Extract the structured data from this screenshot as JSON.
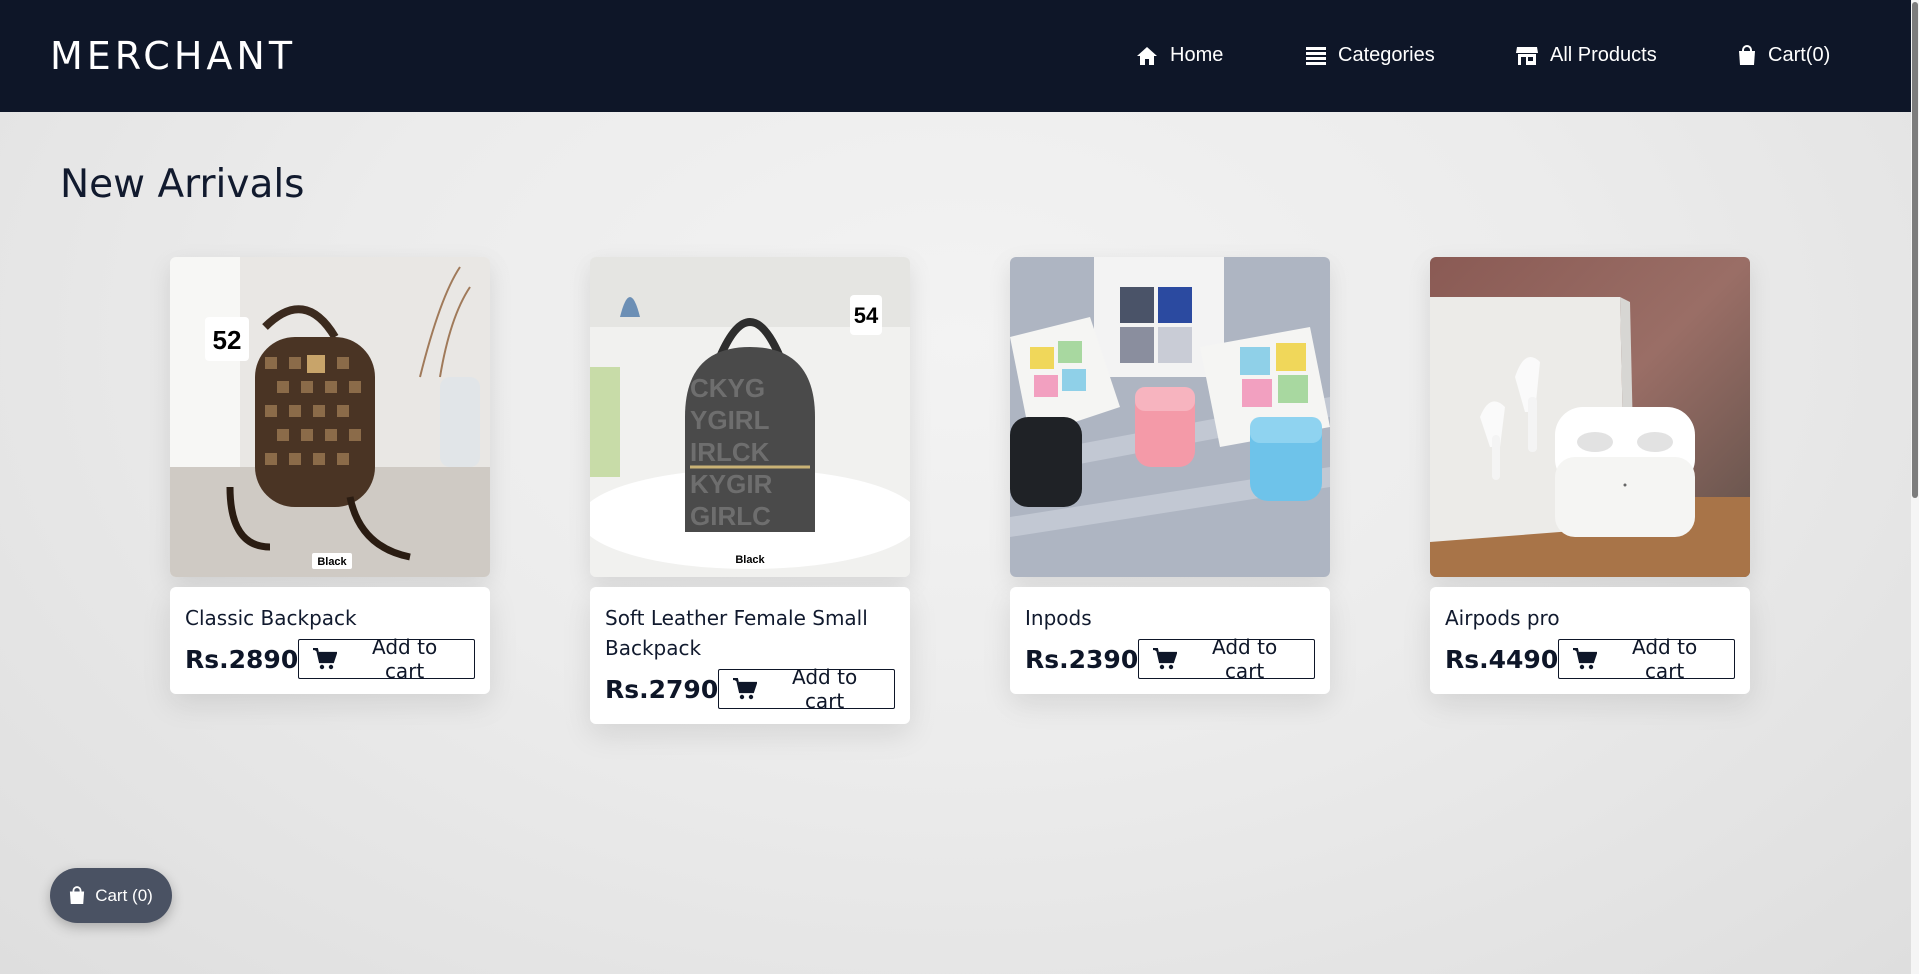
{
  "brand": "MERCHANT",
  "nav": {
    "home": "Home",
    "categories": "Categories",
    "all_products": "All Products",
    "cart": "Cart(0)"
  },
  "section_title": "New Arrivals",
  "products": [
    {
      "name": "Classic Backpack",
      "price": "Rs.2890",
      "button": "Add to cart",
      "badge": "52",
      "tag": "Black"
    },
    {
      "name": "Soft Leather Female Small Backpack",
      "price": "Rs.2790",
      "button": "Add to cart",
      "badge": "54",
      "tag": "Black"
    },
    {
      "name": "Inpods",
      "price": "Rs.2390",
      "button": "Add to cart"
    },
    {
      "name": "Airpods pro",
      "price": "Rs.4490",
      "button": "Add to cart"
    }
  ],
  "floating_cart": "Cart (0)",
  "colors": {
    "navbar": "#0e1628",
    "floating_cart": "#4a5263",
    "accent_text": "#111a2e"
  },
  "icons": [
    "home-icon",
    "list-icon",
    "store-icon",
    "shopping-bag-icon",
    "cart-icon"
  ]
}
